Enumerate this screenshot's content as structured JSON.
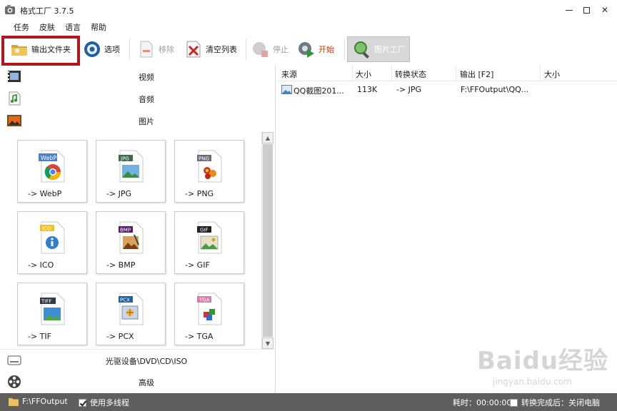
{
  "window": {
    "title": "格式工厂 3.7.5",
    "minimize": "minimize",
    "maximize": "maximize",
    "close": "✕"
  },
  "menu": [
    "任务",
    "皮肤",
    "语言",
    "帮助"
  ],
  "toolbar": {
    "output_folder": "输出文件夹",
    "options": "选项",
    "remove": "移除",
    "clear_list": "清空列表",
    "stop": "停止",
    "start": "开始",
    "image_factory": "图片工厂"
  },
  "categories": {
    "video": "视频",
    "audio": "音频",
    "image": "图片",
    "optical": "光驱设备\\DVD\\CD\\ISO",
    "advanced": "高级"
  },
  "formats": [
    {
      "label": "-> WebP",
      "tag": "WebP",
      "icon": "webp-icon"
    },
    {
      "label": "-> JPG",
      "tag": "JPG",
      "icon": "jpg-icon"
    },
    {
      "label": "-> PNG",
      "tag": "PNG",
      "icon": "png-icon"
    },
    {
      "label": "-> ICO",
      "tag": "ICO",
      "icon": "ico-icon"
    },
    {
      "label": "-> BMP",
      "tag": "BMP",
      "icon": "bmp-icon"
    },
    {
      "label": "-> GIF",
      "tag": "GIF",
      "icon": "gif-icon"
    },
    {
      "label": "-> TIF",
      "tag": "TIFF",
      "icon": "tif-icon"
    },
    {
      "label": "-> PCX",
      "tag": "PCX",
      "icon": "pcx-icon"
    },
    {
      "label": "-> TGA",
      "tag": "TGA",
      "icon": "tga-icon"
    }
  ],
  "table": {
    "headers": [
      "来源",
      "大小",
      "转换状态",
      "输出 [F2]",
      "大小"
    ],
    "rows": [
      {
        "source": "QQ截图201...",
        "size": "113K",
        "status": "-> JPG",
        "output": "F:\\FFOutput\\QQ...",
        "out_size": ""
      }
    ]
  },
  "statusbar": {
    "output_path": "F:\\FFOutput",
    "multithread": "使用多线程",
    "multithread_checked": true,
    "elapsed": "耗时：00:00:00",
    "after_done": "转换完成后：关闭电脑",
    "after_done_checked": false
  },
  "watermark": {
    "text": "Baidu经验",
    "sub": "jingyan.baidu.com"
  },
  "colors": {
    "highlight": "#b3161c",
    "statusbar": "#5e5e5e",
    "start_text": "#cc3a00"
  }
}
